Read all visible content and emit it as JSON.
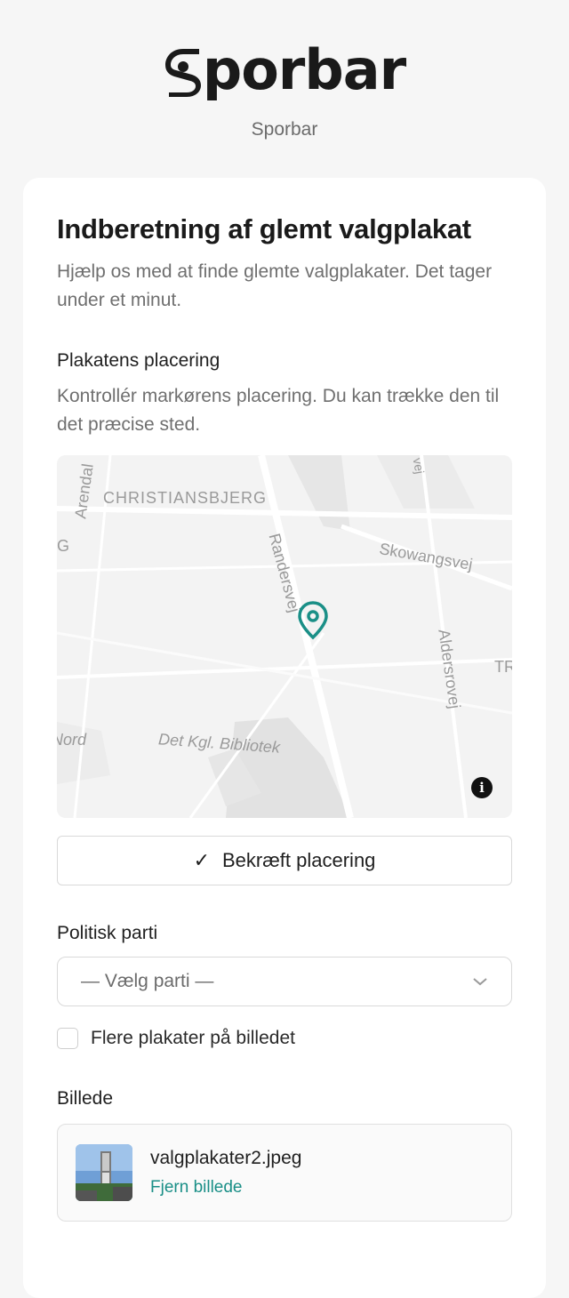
{
  "brand": {
    "logo_text": "porbar",
    "name": "Sporbar"
  },
  "form": {
    "title": "Indberetning af glemt valgplakat",
    "description": "Hjælp os med at finde glemte valgplakater. Det tager under et minut.",
    "location": {
      "label": "Plakatens placering",
      "help": "Kontrollér markørens placering. Du kan trække den til det præcise sted.",
      "map_labels": {
        "christiansbjerg": "CHRISTIANSBJERG",
        "randersvej": "Randersvej",
        "skowangsvej": "Skowangsvej",
        "aldersrovej": "Aldersrovej",
        "bibliotek": "Det Kgl. Bibliotek",
        "arendal": "Arendal",
        "nord": "Nord",
        "vej_top": "vej",
        "g_left": "G",
        "tr_right": "TR"
      },
      "info_icon": "i",
      "confirm_button": "Bekræft placering",
      "accent_color": "#1a8f87"
    },
    "party": {
      "label": "Politisk parti",
      "selected": "— Vælg parti —"
    },
    "multiple_checkbox": {
      "label": "Flere plakater på billedet",
      "checked": false
    },
    "image": {
      "label": "Billede",
      "file_name": "valgplakater2.jpeg",
      "remove_link": "Fjern billede"
    }
  }
}
